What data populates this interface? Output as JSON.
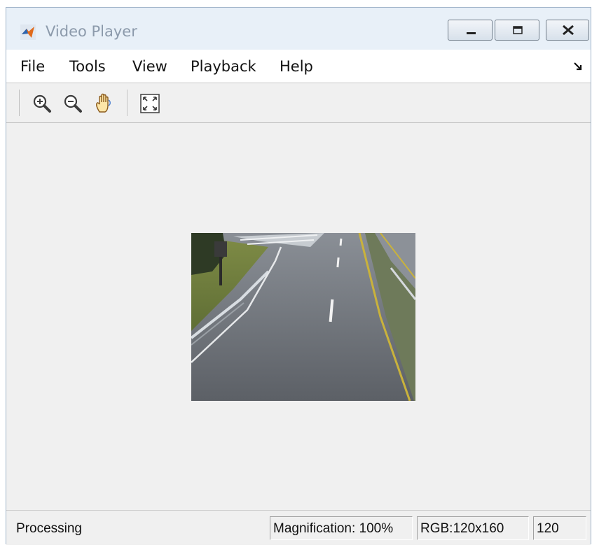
{
  "window": {
    "title": "Video Player",
    "controls": {
      "minimize": "minimize",
      "maximize": "maximize",
      "close": "close"
    }
  },
  "menu": [
    {
      "label": "File"
    },
    {
      "label": "Tools"
    },
    {
      "label": "View"
    },
    {
      "label": "Playback"
    },
    {
      "label": "Help"
    }
  ],
  "toolbar": {
    "tools": [
      "zoom-in-icon",
      "zoom-out-icon",
      "pan-hand-icon",
      "fit-to-window-icon"
    ]
  },
  "status": {
    "message": "Processing",
    "magnification": "Magnification: 100%",
    "image_info": "RGB:120x160",
    "frame": "120"
  },
  "colors": {
    "titlebar": "#e8f0f8",
    "menubar": "#ffffff",
    "panel": "#f0f0f0",
    "title_text": "#8c9aab"
  }
}
